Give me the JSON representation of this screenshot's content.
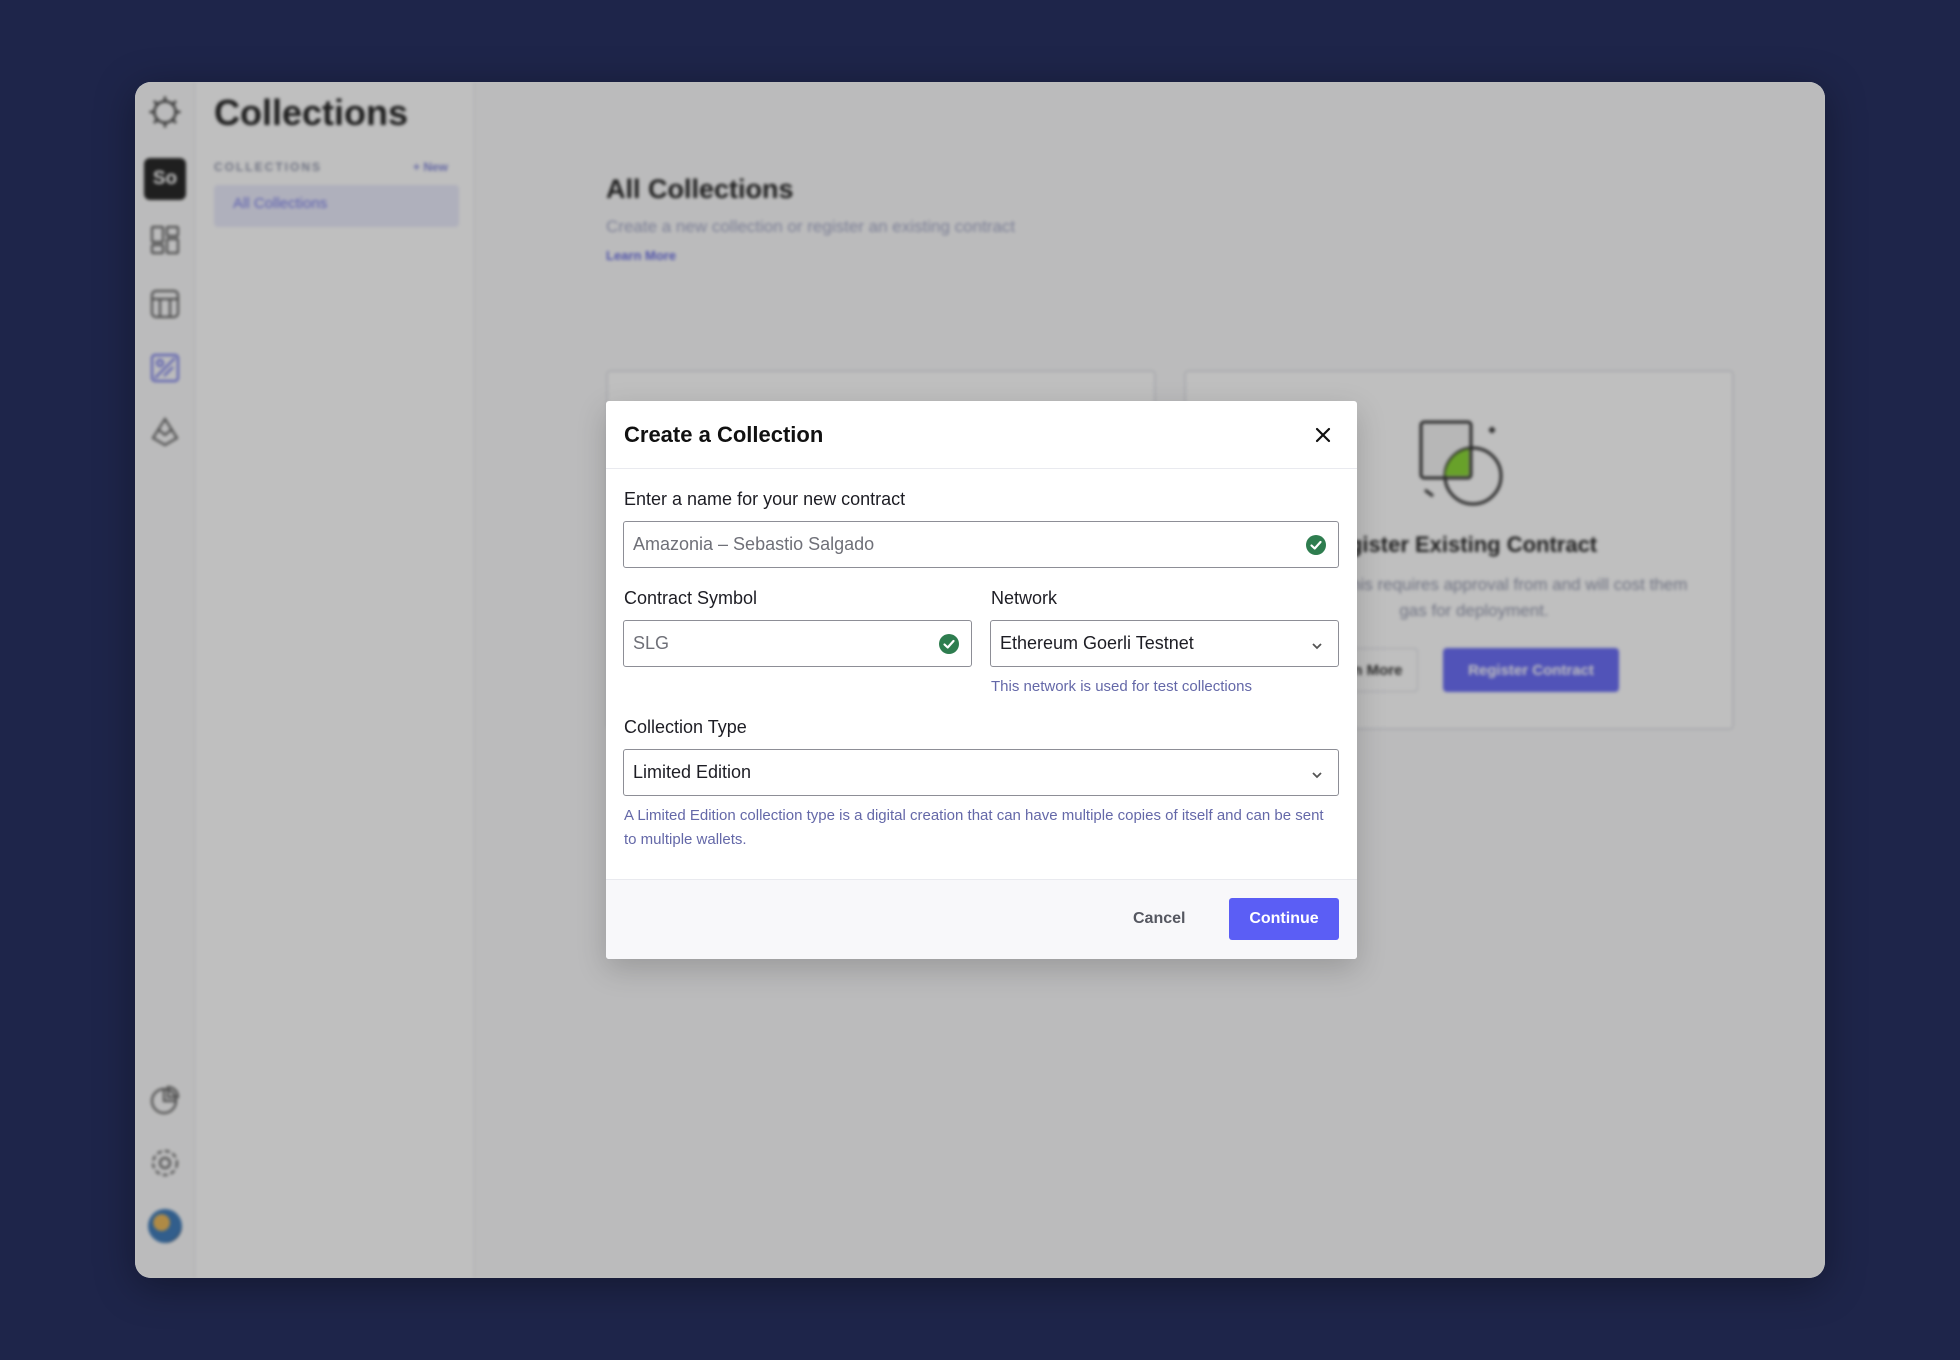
{
  "app": {
    "org_initials": "So",
    "subnav": {
      "title": "Collections",
      "section_label": "COLLECTIONS",
      "new_label": "+ New",
      "items": [
        {
          "label": "All Collections"
        }
      ]
    },
    "main": {
      "title": "All Collections",
      "subtitle": "Create a new collection or register an existing contract",
      "learn_more": "Learn More",
      "register_card": {
        "title": "Register Existing Contract",
        "description": "collection. This requires approval from and will cost them gas for deployment.",
        "learn_more_label": "Learn More",
        "register_label": "Register Contract"
      }
    },
    "rail_icons": [
      "logo-icon",
      "dashboard-icon",
      "storefront-icon",
      "collections-icon",
      "drops-icon",
      "analytics-icon",
      "gear-icon"
    ]
  },
  "modal": {
    "title": "Create a Collection",
    "name_field": {
      "label": "Enter a name for your new contract",
      "value": "Amazonia – Sebastio Salgado",
      "valid": true
    },
    "symbol_field": {
      "label": "Contract Symbol",
      "value": "SLG",
      "valid": true
    },
    "network_field": {
      "label": "Network",
      "selected": "Ethereum Goerli Testnet",
      "hint": "This network is used for test collections"
    },
    "type_field": {
      "label": "Collection Type",
      "selected": "Limited Edition",
      "hint": "A Limited Edition collection type is a digital creation that can have multiple copies of itself and can be sent to multiple wallets."
    },
    "cancel_label": "Cancel",
    "continue_label": "Continue"
  },
  "colors": {
    "backdrop": "#1e254a",
    "accent": "#5b5ef5",
    "success": "#2e7d4f",
    "hint": "#6468a8"
  }
}
